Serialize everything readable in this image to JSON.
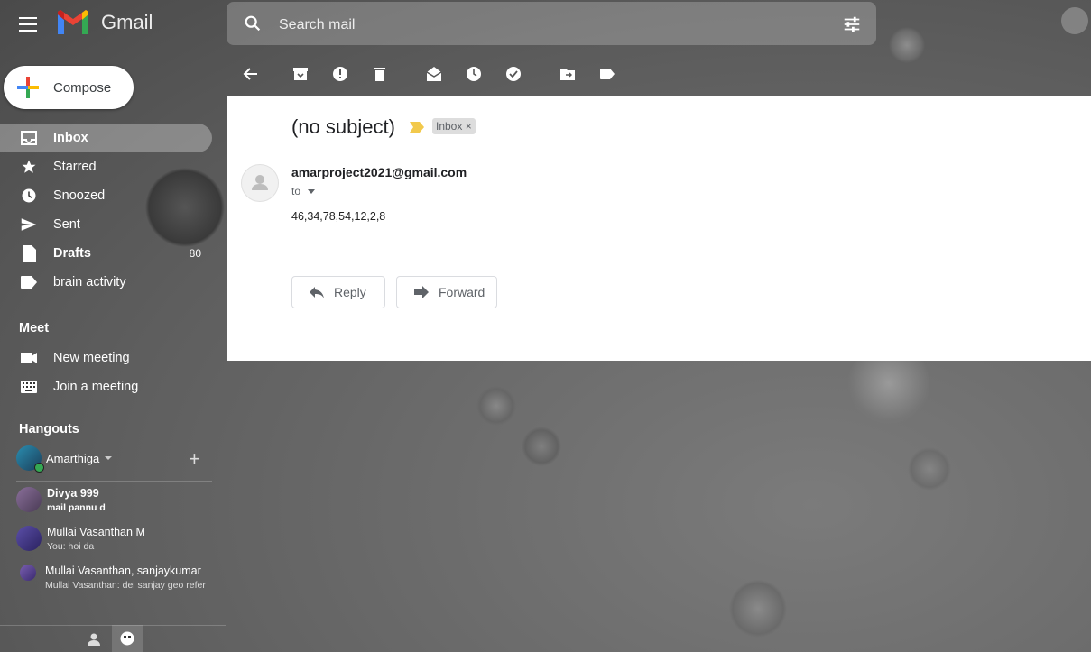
{
  "app": {
    "name": "Gmail"
  },
  "search": {
    "placeholder": "Search mail"
  },
  "compose": {
    "label": "Compose"
  },
  "sidebar": {
    "items": [
      {
        "label": "Inbox",
        "icon": "inbox-icon",
        "active": true
      },
      {
        "label": "Starred",
        "icon": "star-icon"
      },
      {
        "label": "Snoozed",
        "icon": "clock-icon"
      },
      {
        "label": "Sent",
        "icon": "send-icon"
      },
      {
        "label": "Drafts",
        "icon": "draft-icon",
        "count": "80"
      },
      {
        "label": "brain activity",
        "icon": "label-icon"
      }
    ]
  },
  "meet": {
    "title": "Meet",
    "new_meeting": "New meeting",
    "join_meeting": "Join a meeting"
  },
  "hangouts": {
    "title": "Hangouts",
    "user": "Amarthiga",
    "conversations": [
      {
        "name": "Divya 999",
        "preview": "mail pannu d",
        "unread": true
      },
      {
        "name": "Mullai Vasanthan M",
        "preview": "You: hoi da"
      },
      {
        "name": "Mullai Vasanthan, sanjaykumar",
        "preview": "Mullai Vasanthan: dei sanjay geo refer"
      }
    ]
  },
  "email": {
    "subject": "(no subject)",
    "label_badge": "Inbox ×",
    "sender": "amarproject2021@gmail.com",
    "to": "to",
    "body": "46,34,78,54,12,2,8",
    "reply_label": "Reply",
    "forward_label": "Forward"
  },
  "colors": {
    "accent": "#ea4335",
    "importance": "#f2c94c"
  }
}
